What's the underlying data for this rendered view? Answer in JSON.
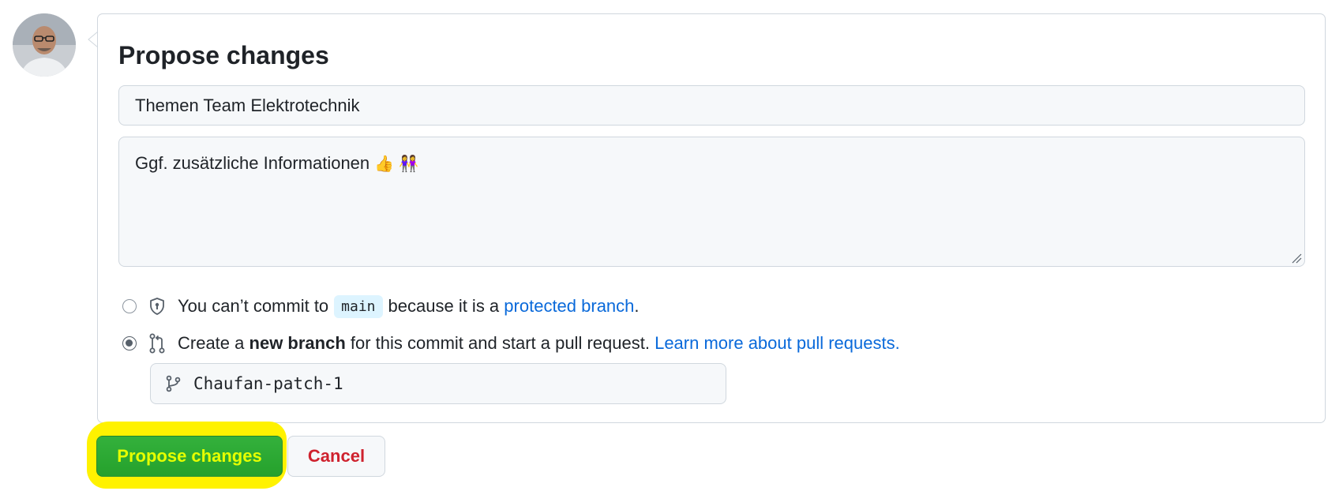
{
  "form": {
    "title": "Propose changes",
    "summary_value": "Themen Team Elektrotechnik",
    "description_value": "Ggf. zusätzliche Informationen",
    "description_emojis": "👍 👭"
  },
  "options": {
    "protected": {
      "text_before": "You can’t commit to",
      "branch": "main",
      "text_middle": "because it is a",
      "link": "protected branch",
      "text_after": "."
    },
    "new_branch": {
      "text_before": "Create a",
      "bold": "new branch",
      "text_middle": "for this commit and start a pull request.",
      "link": "Learn more about pull requests."
    }
  },
  "branch_input": {
    "value": "Chaufan-patch-1"
  },
  "actions": {
    "propose_label": "Propose changes",
    "cancel_label": "Cancel"
  },
  "colors": {
    "accent": "#2da44e",
    "link": "#0969da",
    "danger": "#cf222e",
    "highlight": "#fff200"
  }
}
